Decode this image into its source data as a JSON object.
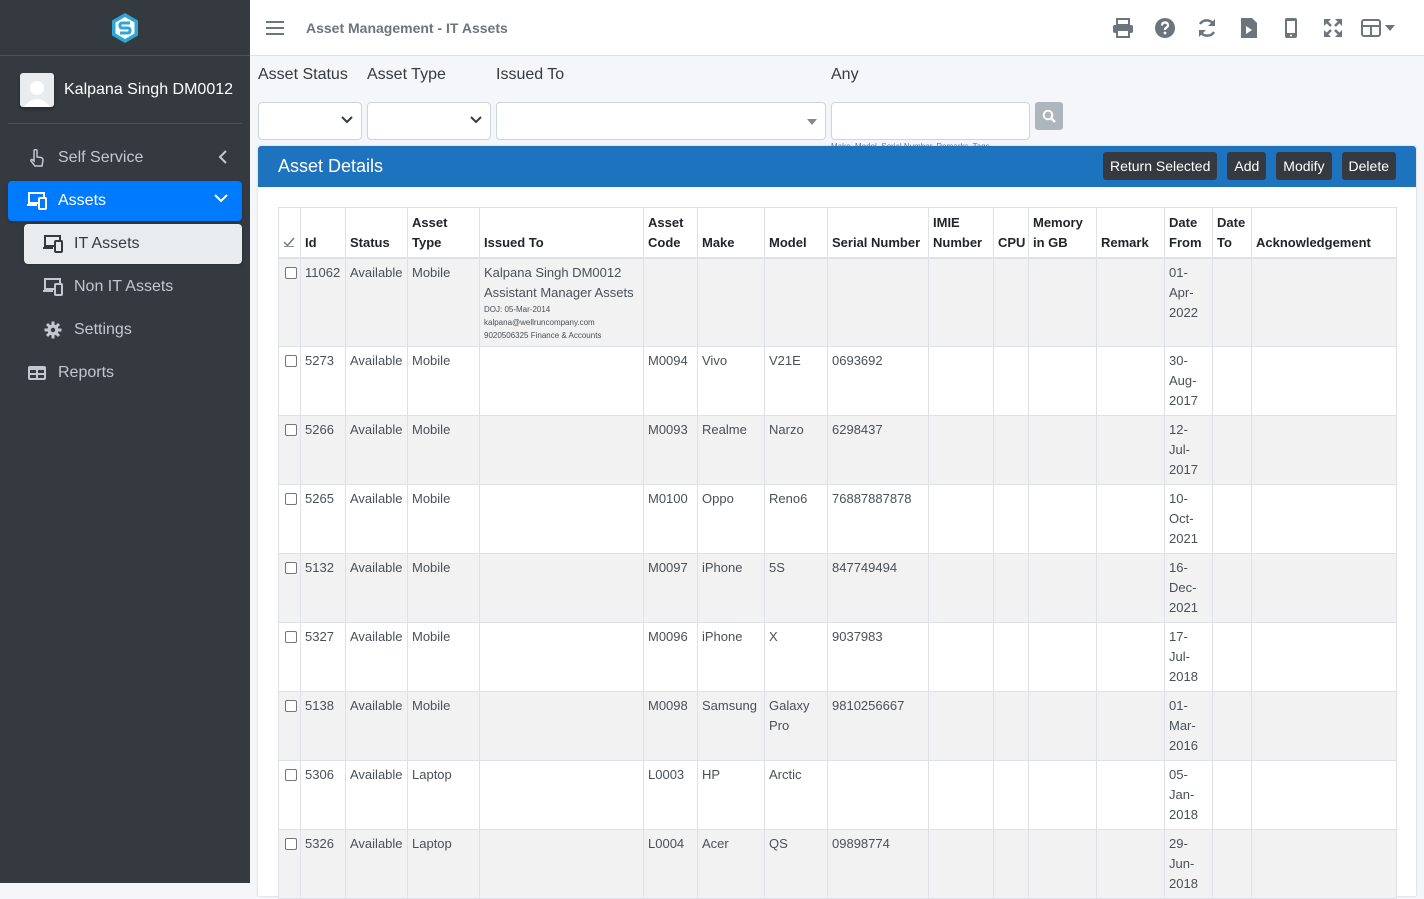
{
  "user": {
    "name": "Kalpana Singh DM0012"
  },
  "sidebar": {
    "items": [
      {
        "label": "Self Service",
        "icon": "hand-pointer-icon"
      },
      {
        "label": "Assets",
        "icon": "devices-icon"
      },
      {
        "label": "IT Assets",
        "icon": "devices-icon"
      },
      {
        "label": "Non IT Assets",
        "icon": "devices-icon"
      },
      {
        "label": "Settings",
        "icon": "gear-icon"
      },
      {
        "label": "Reports",
        "icon": "table-icon"
      }
    ]
  },
  "header": {
    "breadcrumb": "Asset Management - IT Assets"
  },
  "filters": {
    "asset_status_label": "Asset Status",
    "asset_type_label": "Asset Type",
    "issued_to_label": "Issued To",
    "any_label": "Any",
    "any_hint": "Make, Model, Serial Number, Remarks, Tags"
  },
  "card": {
    "title": "Asset Details",
    "buttons": [
      "Return Selected",
      "Add",
      "Modify",
      "Delete"
    ]
  },
  "table": {
    "headers": [
      "Id",
      "Status",
      "Asset Type",
      "Issued To",
      "Asset Code",
      "Make",
      "Model",
      "Serial Number",
      "IMIE Number",
      "CPU",
      "Memory in GB",
      "Remark",
      "Date From",
      "Date To",
      "Acknowledgement"
    ],
    "rows": [
      {
        "id": "11062",
        "status": "Available",
        "type": "Mobile",
        "issued_main": "Kalpana Singh DM0012 Assistant Manager Assets",
        "issued_doj": "DOJ: 05-Mar-2014",
        "issued_email": "kalpana@wellruncompany.com",
        "issued_phone": "9020506325 Finance & Accounts",
        "code": "",
        "make": "",
        "model": "",
        "serial": "",
        "date_from": "01-Apr-2022"
      },
      {
        "id": "5273",
        "status": "Available",
        "type": "Mobile",
        "code": "M0094",
        "make": "Vivo",
        "model": "V21E",
        "serial": "0693692",
        "date_from": "30-Aug-2017"
      },
      {
        "id": "5266",
        "status": "Available",
        "type": "Mobile",
        "code": "M0093",
        "make": "Realme",
        "model": "Narzo",
        "serial": "6298437",
        "date_from": "12-Jul-2017"
      },
      {
        "id": "5265",
        "status": "Available",
        "type": "Mobile",
        "code": "M0100",
        "make": "Oppo",
        "model": "Reno6",
        "serial": "76887887878",
        "date_from": "10-Oct-2021"
      },
      {
        "id": "5132",
        "status": "Available",
        "type": "Mobile",
        "code": "M0097",
        "make": "iPhone",
        "model": "5S",
        "serial": "847749494",
        "date_from": "16-Dec-2021"
      },
      {
        "id": "5327",
        "status": "Available",
        "type": "Mobile",
        "code": "M0096",
        "make": "iPhone",
        "model": "X",
        "serial": "9037983",
        "date_from": "17-Jul-2018"
      },
      {
        "id": "5138",
        "status": "Available",
        "type": "Mobile",
        "code": "M0098",
        "make": "Samsung",
        "model": "Galaxy Pro",
        "serial": "9810256667",
        "date_from": "01-Mar-2016"
      },
      {
        "id": "5306",
        "status": "Available",
        "type": "Laptop",
        "code": "L0003",
        "make": "HP",
        "model": "Arctic",
        "serial": "",
        "date_from": "05-Jan-2018"
      },
      {
        "id": "5326",
        "status": "Available",
        "type": "Laptop",
        "code": "L0004",
        "make": "Acer",
        "model": "QS",
        "serial": "09898774",
        "date_from": "29-Jun-2018"
      }
    ]
  }
}
